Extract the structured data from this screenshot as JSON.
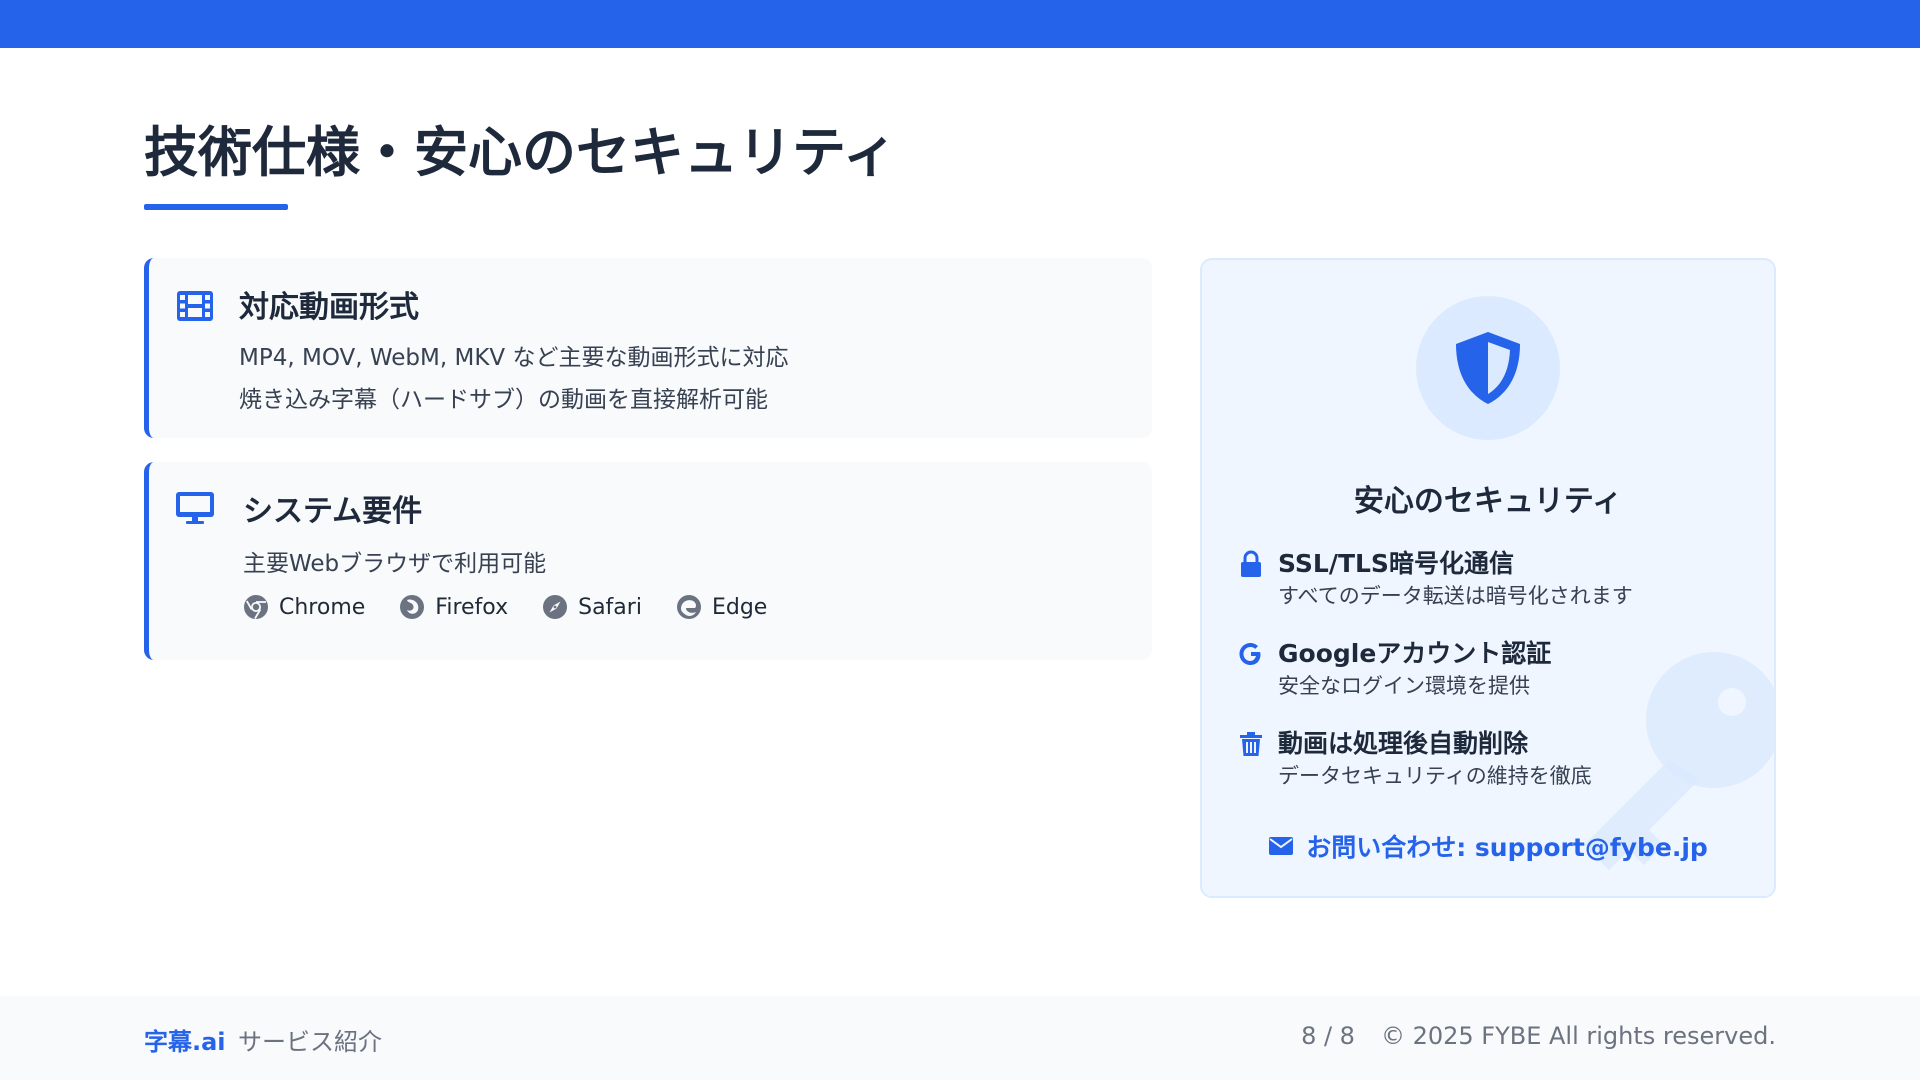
{
  "page": {
    "title": "技術仕様・安心のセキュリティ"
  },
  "formats_card": {
    "icon": "film-icon",
    "title": "対応動画形式",
    "lines": [
      "MP4, MOV, WebM, MKV など主要な動画形式に対応",
      "焼き込み字幕（ハードサブ）の動画を直接解析可能"
    ]
  },
  "system_card": {
    "icon": "monitor-icon",
    "title": "システム要件",
    "line": "主要Webブラウザで利用可能",
    "browsers": [
      {
        "name": "Chrome",
        "icon": "chrome-icon"
      },
      {
        "name": "Firefox",
        "icon": "firefox-icon"
      },
      {
        "name": "Safari",
        "icon": "safari-icon"
      },
      {
        "name": "Edge",
        "icon": "edge-icon"
      }
    ]
  },
  "security": {
    "icon": "shield-icon",
    "title": "安心のセキュリティ",
    "items": [
      {
        "icon": "lock-icon",
        "heading": "SSL/TLS暗号化通信",
        "sub": "すべてのデータ転送は暗号化されます"
      },
      {
        "icon": "google-icon",
        "heading": "Googleアカウント認証",
        "sub": "安全なログイン環境を提供"
      },
      {
        "icon": "trash-icon",
        "heading": "動画は処理後自動削除",
        "sub": "データセキュリティの維持を徹底"
      }
    ],
    "contact": "お問い合わせ: support@fybe.jp"
  },
  "footer": {
    "brand": "字幕.ai",
    "subtitle": "サービス紹介",
    "page_number": "8 / 8",
    "copyright": "© 2025 FYBE All rights reserved."
  },
  "colors": {
    "accent": "#2563eb",
    "panel_bg": "#eff6ff",
    "card_bg": "#f8fafc"
  }
}
